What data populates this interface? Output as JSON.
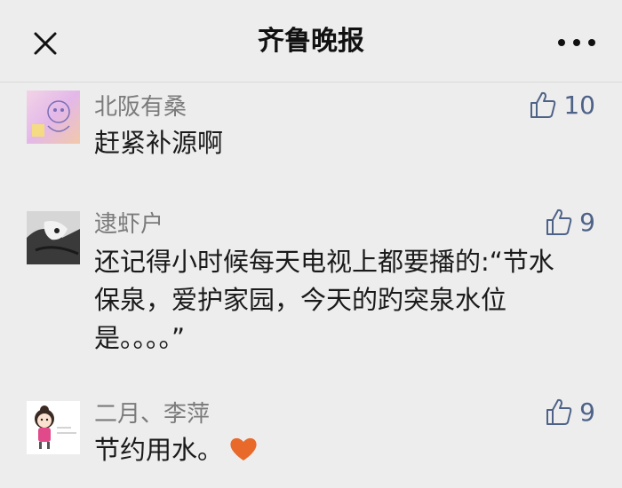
{
  "header": {
    "title": "齐鲁晚报",
    "close_icon": "close-icon",
    "more_icon": "more-options-icon"
  },
  "colors": {
    "background": "#ededed",
    "like_accent": "#4e6288",
    "author_gray": "#7b7b7b",
    "heart": "#e8692a"
  },
  "comments": [
    {
      "author": "北阪有桑",
      "likes": "10",
      "lines": [
        "赶紧补源啊"
      ]
    },
    {
      "author": "逮虾户",
      "likes": "9",
      "lines": [
        "还记得小时候每天电视上都要播的:“节水",
        "保泉，爱护家园，今天的趵突泉水位",
        "是。。。。”"
      ]
    },
    {
      "author": "二月、李萍",
      "likes": "9",
      "lines": [
        "节约用水。"
      ],
      "emoji": "orange-heart-icon"
    }
  ]
}
